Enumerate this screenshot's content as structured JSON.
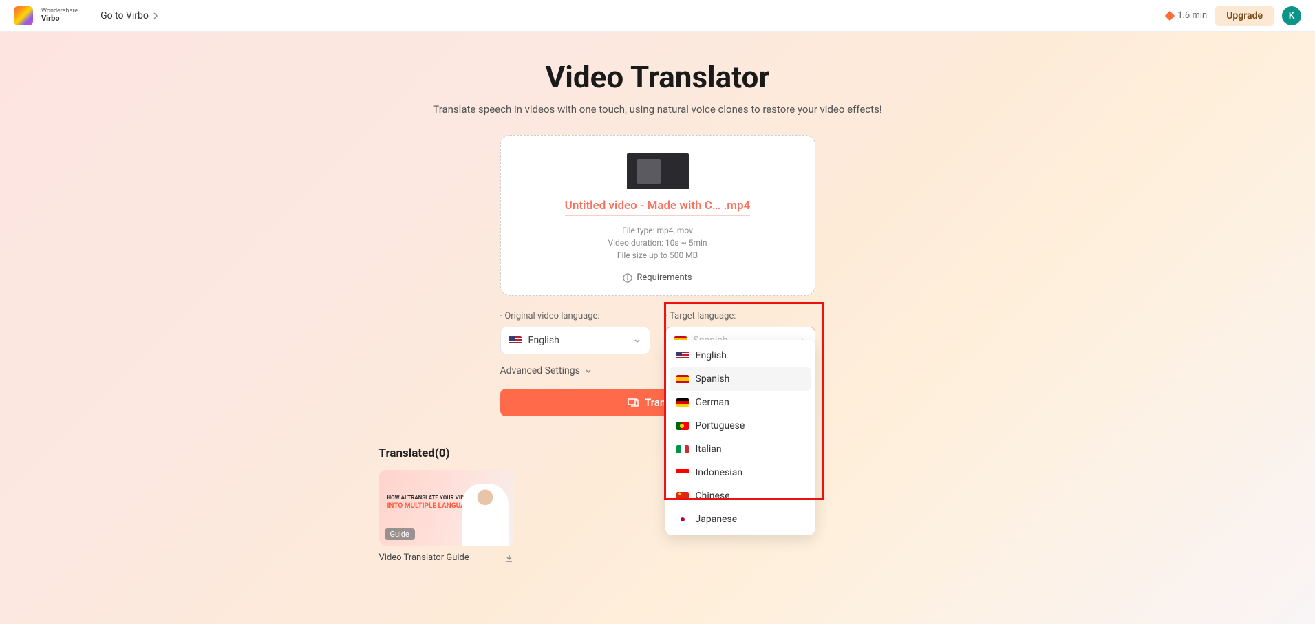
{
  "header": {
    "brand_top": "Wondershare",
    "brand_bottom": "Virbo",
    "goto_label": "Go to Virbo",
    "time_left": "1.6 min",
    "upgrade_label": "Upgrade",
    "avatar_initial": "K"
  },
  "page": {
    "title": "Video Translator",
    "subtitle": "Translate speech in videos with one touch, using natural voice clones to restore your video effects!"
  },
  "upload": {
    "filename": "Untitled video - Made with C… .mp4",
    "req_type": "File type: mp4, mov",
    "req_duration": "Video duration: 10s ~ 5min",
    "req_size": "File size up to 500 MB",
    "requirements_label": "Requirements"
  },
  "lang": {
    "original_label": "Original video language:",
    "target_label": "Target language:",
    "original_value": "English",
    "target_value": "Spanish",
    "options": [
      {
        "label": "English",
        "flag": "us"
      },
      {
        "label": "Spanish",
        "flag": "es"
      },
      {
        "label": "German",
        "flag": "de"
      },
      {
        "label": "Portuguese",
        "flag": "pt"
      },
      {
        "label": "Italian",
        "flag": "it"
      },
      {
        "label": "Indonesian",
        "flag": "id"
      },
      {
        "label": "Chinese",
        "flag": "cn"
      },
      {
        "label": "Japanese",
        "flag": "jp"
      }
    ]
  },
  "advanced_label": "Advanced Settings",
  "translate_btn": "Translate",
  "translated": {
    "heading": "Translated(0)",
    "guide_small": "HOW AI TRANSLATE YOUR VIDEOS",
    "guide_big": "INTO MULTIPLE LANGUAGES",
    "badge": "Guide",
    "item_label": "Video Translator Guide"
  }
}
